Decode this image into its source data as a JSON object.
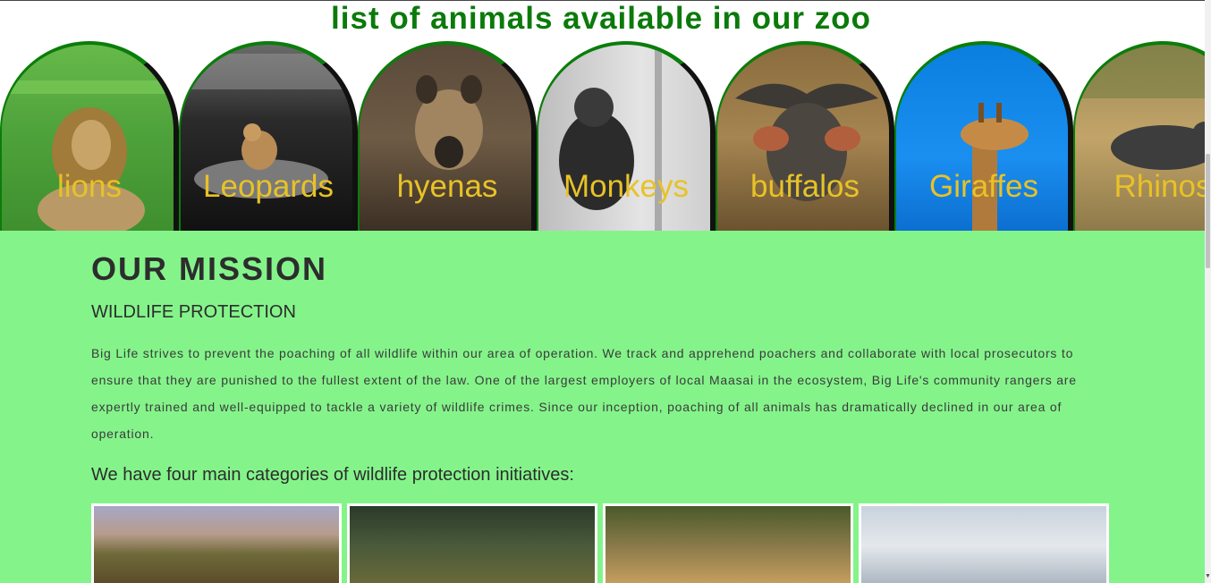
{
  "header": {
    "title": "list of animals available in our zoo"
  },
  "animals": [
    {
      "label": "lions",
      "icon": "lion-photo"
    },
    {
      "label": "Leopards",
      "icon": "leopard-photo"
    },
    {
      "label": "hyenas",
      "icon": "hyena-photo"
    },
    {
      "label": "Monkeys",
      "icon": "monkey-photo"
    },
    {
      "label": "buffalos",
      "icon": "buffalo-photo"
    },
    {
      "label": "Giraffes",
      "icon": "giraffe-photo"
    },
    {
      "label": "Rhinos",
      "icon": "rhino-photo"
    }
  ],
  "mission": {
    "heading": "OUR MISSION",
    "subheading": "WILDLIFE PROTECTION",
    "body": "Big Life strives to prevent the poaching of all wildlife within our area of operation. We track and apprehend poachers and collaborate with local prosecutors to ensure that they are punished to the fullest extent of the law. One of the largest employers of local Maasai in the ecosystem, Big Life's community rangers are expertly trained and well-equipped to tackle a variety of wildlife crimes. Since our inception, poaching of all animals has dramatically declined in our area of operation.",
    "categories_intro": "We have four main categories of wildlife protection initiatives:"
  },
  "colors": {
    "title_green": "#0b7a0b",
    "label_yellow": "#e8c227",
    "mission_bg": "#84f48a",
    "text_dark": "#2d2d2d"
  }
}
